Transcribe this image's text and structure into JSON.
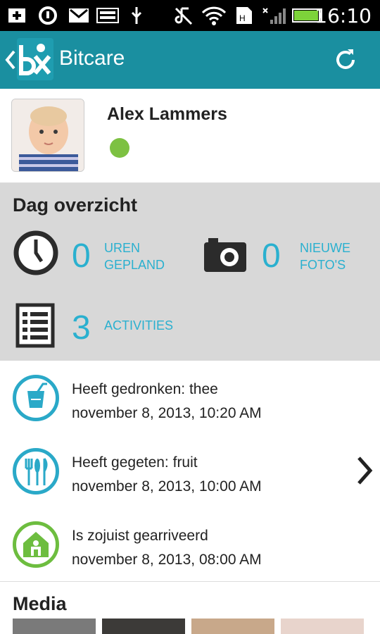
{
  "statusbar": {
    "time": "16:10",
    "icons": [
      "plus-icon",
      "sync-icon",
      "gmail-icon",
      "keyboard-icon",
      "usb-icon",
      "music-muted-icon",
      "wifi-icon",
      "sd-card-icon",
      "signal-icon",
      "battery-icon"
    ]
  },
  "actionbar": {
    "title": "Bitcare",
    "logo": "bitcare-logo",
    "back_icon": "chevron-left-icon",
    "refresh_icon": "refresh-icon"
  },
  "profile": {
    "name": "Alex Lammers",
    "status_color": "#7dc142"
  },
  "overview": {
    "title": "Dag overzicht",
    "stats": [
      {
        "icon": "clock-icon",
        "value": "0",
        "label_line1": "UREN",
        "label_line2": "GEPLAND"
      },
      {
        "icon": "camera-icon",
        "value": "0",
        "label_line1": "NIEUWE",
        "label_line2": "FOTO'S"
      },
      {
        "icon": "list-icon",
        "value": "3",
        "label_line1": "ACTIVITIES",
        "label_line2": ""
      }
    ]
  },
  "activities": [
    {
      "icon": "drink-icon",
      "title": "Heeft gedronken: thee",
      "date": "november 8, 2013, 10:20 AM"
    },
    {
      "icon": "cutlery-icon",
      "title": "Heeft gegeten: fruit",
      "date": "november 8, 2013, 10:00 AM"
    },
    {
      "icon": "house-icon",
      "title": "Is zojuist gearriveerd",
      "date": "november 8, 2013, 08:00 AM"
    }
  ],
  "media": {
    "title": "Media"
  },
  "colors": {
    "accent": "#1a8fa0",
    "highlight": "#2ab0cf",
    "green": "#6dbd3f"
  }
}
